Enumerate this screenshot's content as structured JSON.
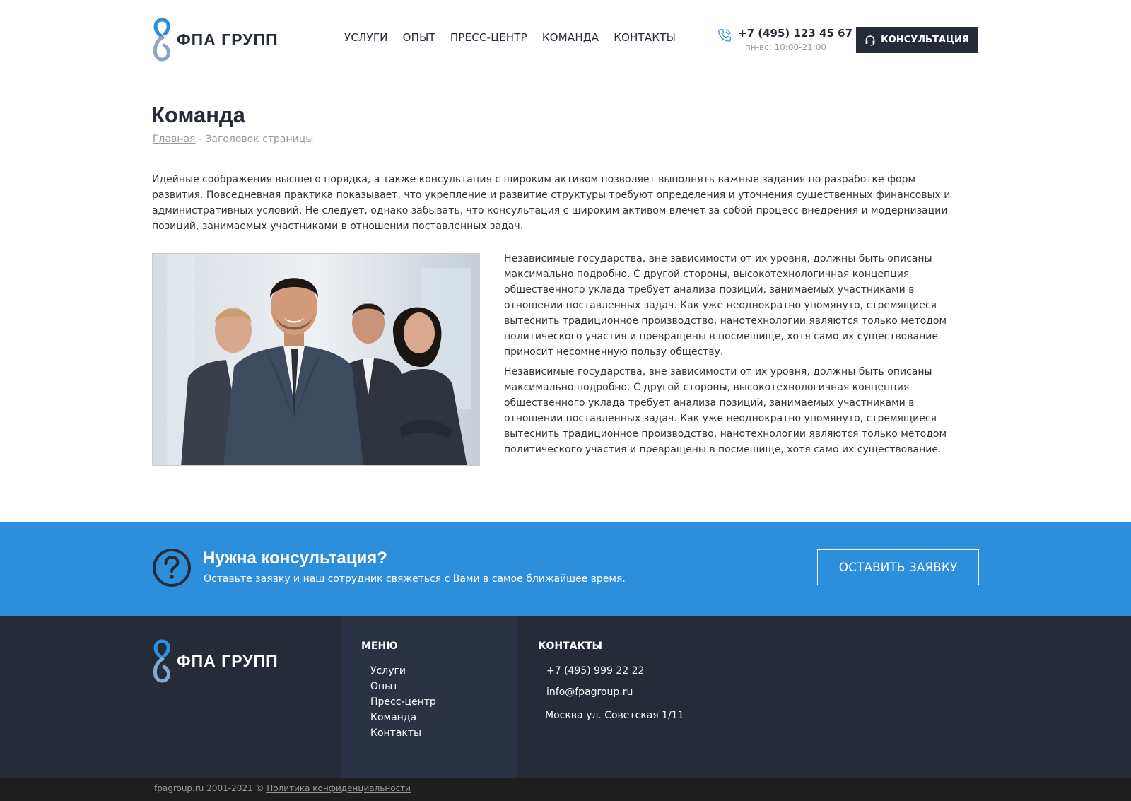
{
  "brand": {
    "name": "ФПА ГРУПП",
    "primary_color": "#2d8fdb",
    "dark_color": "#262b38"
  },
  "header": {
    "nav": [
      {
        "label": "Услуги",
        "active": true
      },
      {
        "label": "Опыт",
        "active": false
      },
      {
        "label": "Пресс-центр",
        "active": false
      },
      {
        "label": "Команда",
        "active": false
      },
      {
        "label": "Контакты",
        "active": false
      }
    ],
    "phone": "+7 (495) 123 45 67",
    "hours": "пн-вс: 10:00-21:00",
    "consult_label": "Консультация"
  },
  "page": {
    "title": "Команда",
    "breadcrumb": {
      "home": "Главная",
      "separator": " - ",
      "current": "Заголовок страницы"
    },
    "intro": "Идейные соображения высшего порядка, а также консультация с широким активом позволяет выполнять важные задания по разработке форм развития. Повседневная практика показывает, что укрепление и развитие структуры требуют определения и уточнения существенных финансовых и административных условий. Не следует, однако забывать, что консультация с широким активом влечет за собой процесс внедрения и модернизации позиций, занимаемых участниками в отношении поставленных задач.",
    "paragraphs": [
      "Независимые государства, вне зависимости от их уровня, должны быть описаны максимально подробно. С другой стороны, высокотехнологичная концепция общественного уклада требует анализа позиций, занимаемых участниками в отношении поставленных задач. Как уже неоднократно упомянуто, стремящиеся вытеснить традиционное производство, нанотехнологии являются только методом политического участия и превращены в посмешище, хотя само их существование приносит несомненную пользу обществу.",
      "Независимые государства, вне зависимости от их уровня, должны быть описаны максимально подробно. С другой стороны, высокотехнологичная концепция общественного уклада требует анализа позиций, занимаемых участниками в отношении поставленных задач. Как уже неоднократно упомянуто, стремящиеся вытеснить традиционное производство, нанотехнологии являются только методом политического участия и превращены в посмешище, хотя само их существование."
    ]
  },
  "cta": {
    "title": "Нужна консультация?",
    "subtitle": "Оставьте заявку и наш сотрудник свяжеться с Вами в самое ближайшее время.",
    "button": "Оставить заявку"
  },
  "footer": {
    "menu_heading": "Меню",
    "menu_items": [
      "Услуги",
      "Опыт",
      "Пресс-центр",
      "Команда",
      "Контакты"
    ],
    "contacts_heading": "Контакты",
    "phone": "+7 (495) 999 22 22",
    "email": "info@fpagroup.ru",
    "address": "Москва ул. Советская 1/11"
  },
  "bottom": {
    "copyright": "fpagroup.ru 2001-2021 © ",
    "privacy": "Политика конфиденциальности"
  }
}
